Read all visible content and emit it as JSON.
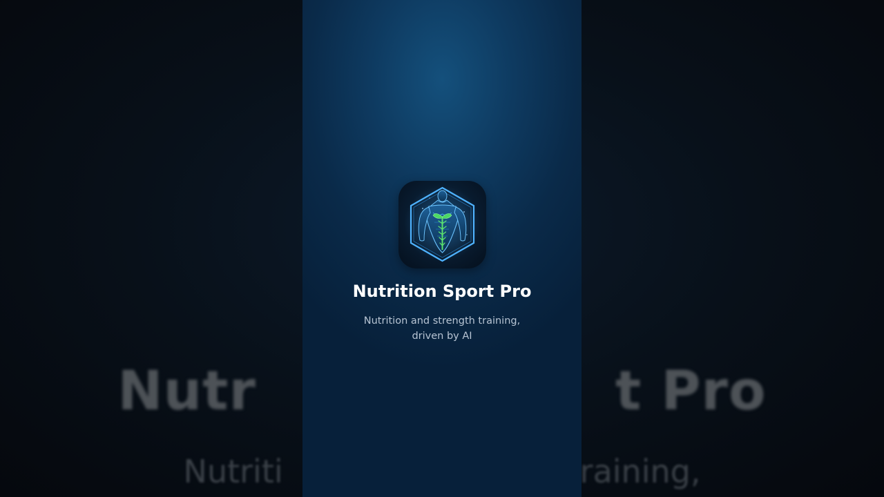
{
  "splash": {
    "app_name": "Nutrition Sport Pro",
    "tagline": "Nutrition and strength training, driven by AI",
    "icon": "muscular-figure-hexagon-icon"
  },
  "background": {
    "title_fragment_left": "Nutr",
    "title_fragment_right": "t Pro",
    "subtitle_fragment_left": "Nutriti",
    "subtitle_fragment_right": "raining,"
  },
  "colors": {
    "accent_blue": "#2f9be0",
    "accent_green": "#4cd964",
    "screen_bg": "#0e3a60"
  }
}
